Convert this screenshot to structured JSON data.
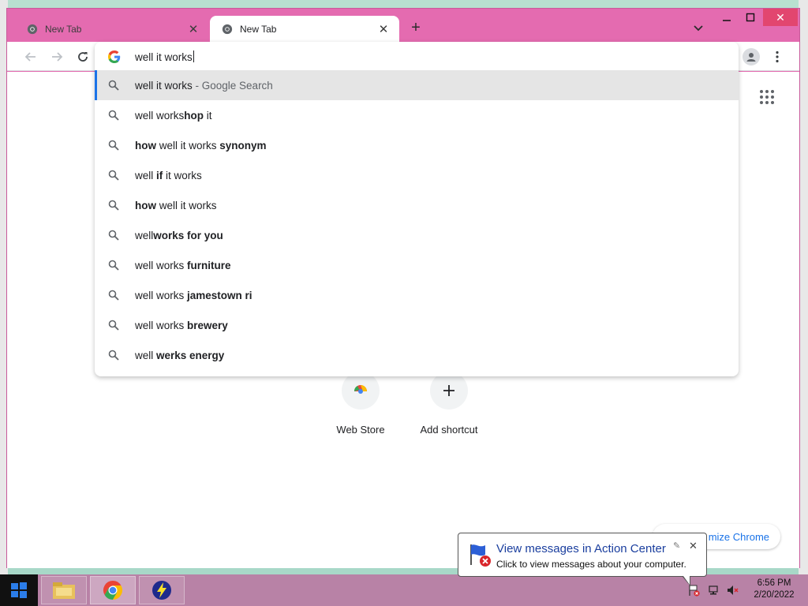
{
  "browser": {
    "tabs": [
      {
        "title": "New Tab",
        "active": false
      },
      {
        "title": "New Tab",
        "active": true
      }
    ],
    "accent_color": "#e46bb0"
  },
  "omnibox": {
    "value": "well it works",
    "suggestions": [
      {
        "parts": [
          {
            "t": "well it works",
            "b": false
          },
          {
            "t": " - Google Search",
            "b": false,
            "suffix": true
          }
        ],
        "selected": true
      },
      {
        "parts": [
          {
            "t": "well works",
            "b": false
          },
          {
            "t": "hop",
            "b": true
          },
          {
            "t": " it",
            "b": false
          }
        ]
      },
      {
        "parts": [
          {
            "t": "how",
            "b": true
          },
          {
            "t": " well it works ",
            "b": false
          },
          {
            "t": "synonym",
            "b": true
          }
        ]
      },
      {
        "parts": [
          {
            "t": "well ",
            "b": false
          },
          {
            "t": "if",
            "b": true
          },
          {
            "t": " it works",
            "b": false
          }
        ]
      },
      {
        "parts": [
          {
            "t": "how",
            "b": true
          },
          {
            "t": " well it works",
            "b": false
          }
        ]
      },
      {
        "parts": [
          {
            "t": "well",
            "b": false
          },
          {
            "t": "works for you",
            "b": true
          }
        ]
      },
      {
        "parts": [
          {
            "t": "well works ",
            "b": false
          },
          {
            "t": "furniture",
            "b": true
          }
        ]
      },
      {
        "parts": [
          {
            "t": "well works ",
            "b": false
          },
          {
            "t": "jamestown ri",
            "b": true
          }
        ]
      },
      {
        "parts": [
          {
            "t": "well works ",
            "b": false
          },
          {
            "t": "brewery",
            "b": true
          }
        ]
      },
      {
        "parts": [
          {
            "t": "well ",
            "b": false
          },
          {
            "t": "werks energy",
            "b": true
          }
        ]
      }
    ]
  },
  "shortcuts": [
    {
      "label": "Web Store",
      "icon": "chrome-web-store-icon"
    },
    {
      "label": "Add shortcut",
      "icon": "plus-icon"
    }
  ],
  "customize": {
    "label": "mize Chrome"
  },
  "notification": {
    "title": "View messages in Action Center",
    "text": "Click to view messages about your computer."
  },
  "taskbar": {
    "items": [
      "file-explorer-icon",
      "chrome-icon",
      "lightning-app-icon"
    ],
    "clock_time": "6:56 PM",
    "clock_date": "2/20/2022"
  }
}
